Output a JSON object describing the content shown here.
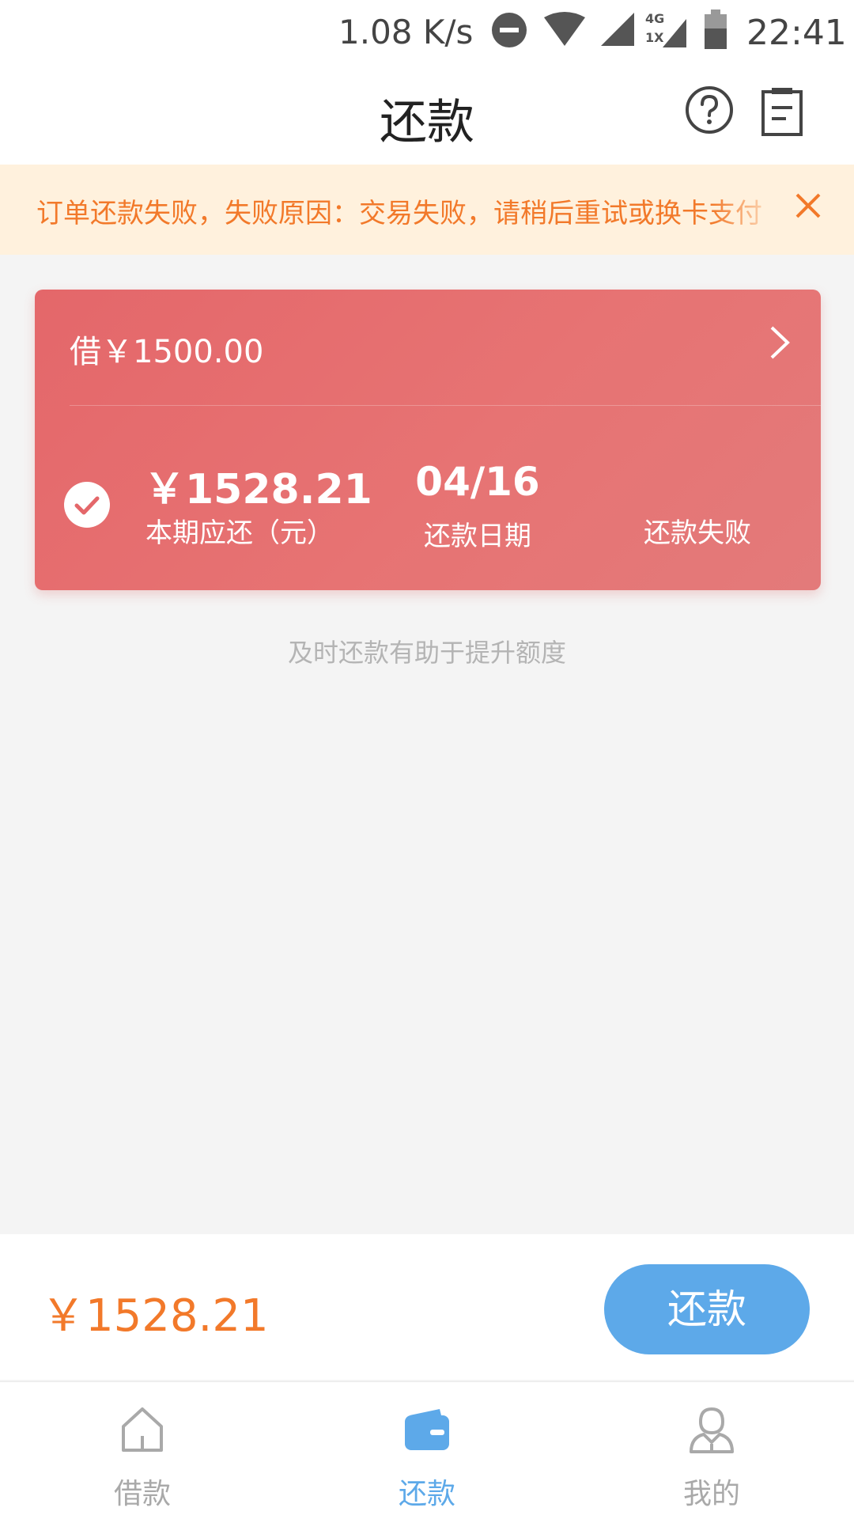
{
  "status_bar": {
    "net_speed": "1.08 K/s",
    "time": "22:41",
    "network_badge_top": "4G",
    "network_badge_bottom": "1X"
  },
  "header": {
    "title": "还款",
    "help_icon": "question-circle-icon",
    "records_icon": "clipboard-icon"
  },
  "notice": {
    "text": "订单还款失败，失败原因：交易失败，请稍后重试或换卡支付"
  },
  "loan_card": {
    "principal": "借￥1500.00",
    "amount_due": "￥1528.21",
    "amount_label": "本期应还（元）",
    "due_date": "04/16",
    "due_label": "还款日期",
    "status": "还款失败"
  },
  "tip": "及时还款有助于提升额度",
  "pay_bar": {
    "total": "￥1528.21",
    "button_label": "还款"
  },
  "nav": {
    "items": [
      {
        "label": "借款",
        "icon": "home-icon",
        "active": false
      },
      {
        "label": "还款",
        "icon": "wallet-icon",
        "active": true
      },
      {
        "label": "我的",
        "icon": "person-icon",
        "active": false
      }
    ]
  },
  "colors": {
    "accent_orange": "#f2792a",
    "card_red": "#e4676a",
    "primary_blue": "#5da9e9",
    "notice_bg": "#fff1dd"
  }
}
